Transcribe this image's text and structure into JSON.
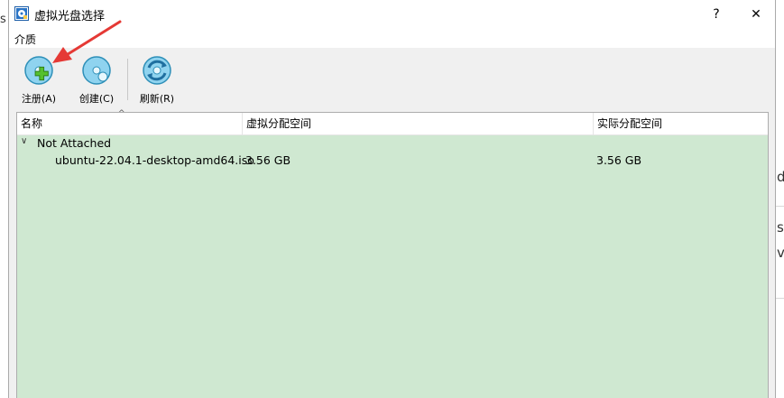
{
  "window": {
    "title": "虚拟光盘选择",
    "help_button": "?",
    "close_button": "✕"
  },
  "menu": {
    "items": [
      {
        "label": "介质"
      }
    ]
  },
  "toolbar": {
    "buttons": [
      {
        "label": "注册(A)",
        "icon": "register-disk-icon"
      },
      {
        "label": "创建(C)",
        "icon": "create-disk-icon"
      },
      {
        "label": "刷新(R)",
        "icon": "refresh-disk-icon"
      }
    ]
  },
  "table": {
    "columns": [
      "名称",
      "虚拟分配空间",
      "实际分配空间"
    ],
    "sort_indicator": "^",
    "group": {
      "chevron": "∨",
      "label": "Not Attached"
    },
    "rows": [
      {
        "name": "ubuntu-22.04.1-desktop-amd64.iso",
        "virtual_size": "3.56 GB",
        "actual_size": "3.56 GB"
      }
    ]
  },
  "background": {
    "left_letter": "s",
    "right_letters": [
      "d",
      "s",
      "v"
    ]
  },
  "colors": {
    "list_background": "#cfe8d1",
    "annotation_arrow": "#e53935"
  }
}
